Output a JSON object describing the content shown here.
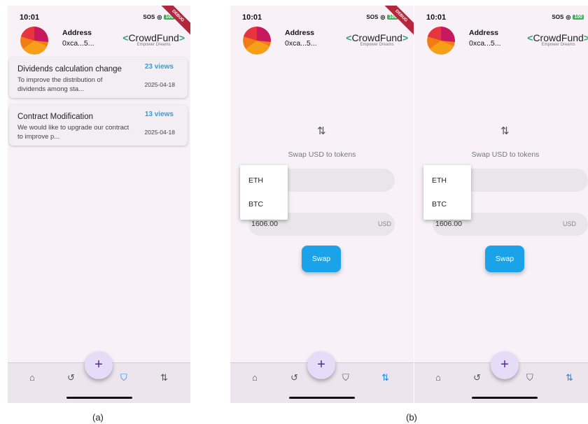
{
  "status": {
    "time": "10:01",
    "sos": "SOS",
    "battery": "100",
    "ribbon": "DEBUG"
  },
  "header": {
    "address_label": "Address",
    "address_value": "0xca...5...",
    "brand_name": "CrowdFund",
    "brand_tagline": "Empower Dreams"
  },
  "proposals": [
    {
      "title": "Dividends calculation change",
      "views": "23 views",
      "description": "To improve the distribution of dividends among sta...",
      "date": "2025-04-18"
    },
    {
      "title": "Contract Modification",
      "views": "13 views",
      "description": "We would like to upgrade our contract to improve p...",
      "date": "2025-04-18"
    }
  ],
  "swap": {
    "icon": "swap-vertical-icon",
    "label": "Swap USD to tokens",
    "amount": "1606.00",
    "unit": "USD",
    "button_label": "Swap",
    "token_options": [
      "ETH",
      "BTC"
    ]
  },
  "nav": {
    "fab_label": "+",
    "items": [
      "home-icon",
      "history-icon",
      "vote-icon",
      "swap-icon"
    ]
  },
  "captions": {
    "a": "(a)",
    "b": "(b)"
  },
  "colors": {
    "accent": "#1e88e5",
    "views": "#2aa1e0",
    "swap_button": "#1aa3e8",
    "brand_chevron": "#2ca56f",
    "fab": "#e6dcf7",
    "background": "#f8f2f8"
  }
}
